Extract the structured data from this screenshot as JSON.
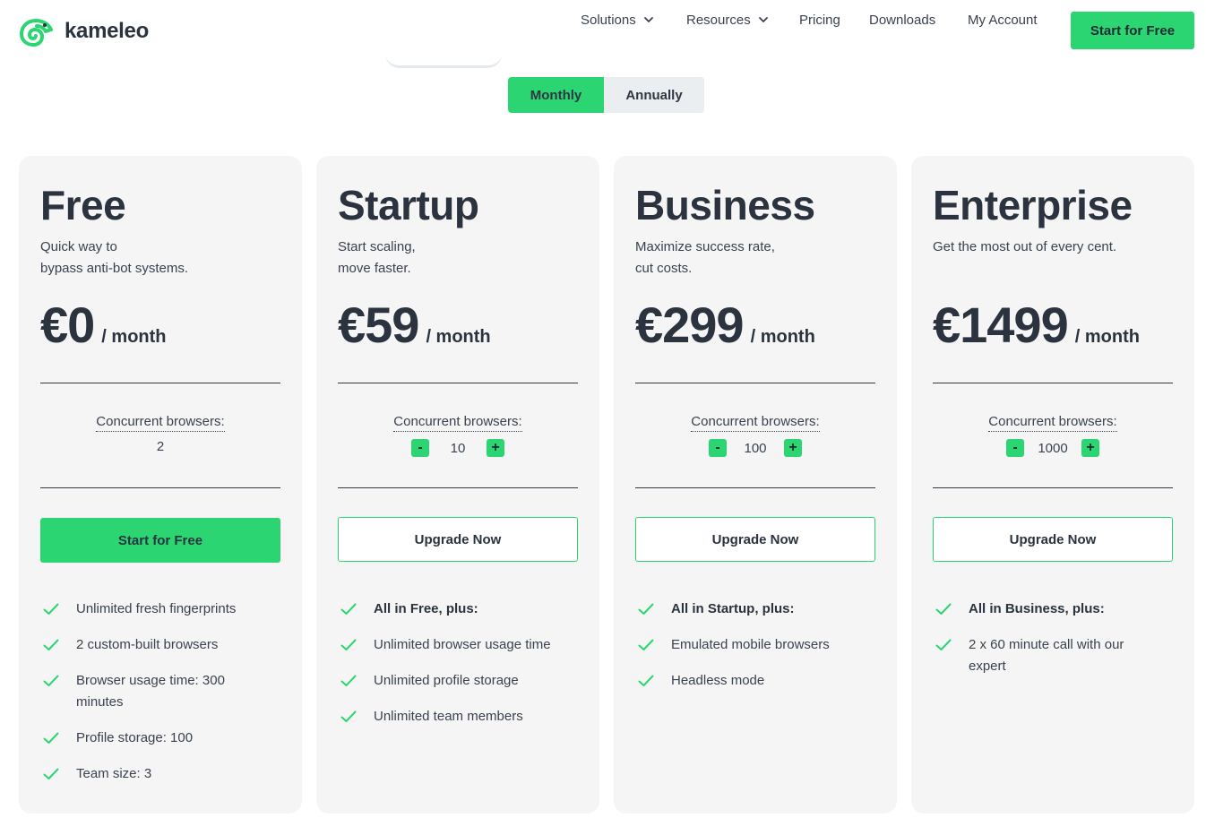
{
  "brand": {
    "name": "kameleo",
    "accent": "#2bd672"
  },
  "nav": {
    "solutions": "Solutions",
    "resources": "Resources",
    "pricing": "Pricing",
    "downloads": "Downloads",
    "my_account": "My Account",
    "cta": "Start for Free"
  },
  "billing": {
    "monthly": "Monthly",
    "annually": "Annually",
    "selected": "Monthly"
  },
  "plans": [
    {
      "name": "Free",
      "desc": [
        "Quick way to",
        "bypass anti-bot systems."
      ],
      "price": "€0",
      "period": "/ month",
      "conc_label": "Concurrent browsers:",
      "conc_value": "2",
      "button": "Start for Free",
      "features": [
        "Unlimited fresh fingerprints",
        "2 custom-built browsers",
        "Browser usage time: 300 minutes",
        "Profile storage: 100",
        "Team size: 3"
      ]
    },
    {
      "name": "Startup",
      "desc": [
        "Start scaling,",
        "move faster."
      ],
      "price": "€59",
      "period": "/ month",
      "conc_label": "Concurrent browsers:",
      "conc_value": "10",
      "button": "Upgrade Now",
      "features": [
        "All in Free, plus:",
        "Unlimited browser usage time",
        "Unlimited profile storage",
        "Unlimited team members"
      ]
    },
    {
      "name": "Business",
      "desc": [
        "Maximize success rate,",
        "cut costs."
      ],
      "price": "€299",
      "period": "/ month",
      "conc_label": "Concurrent browsers:",
      "conc_value": "100",
      "button": "Upgrade Now",
      "features": [
        "All in Startup, plus:",
        "Emulated mobile browsers",
        "Headless mode"
      ]
    },
    {
      "name": "Enterprise",
      "desc": [
        "Get the most out of every cent."
      ],
      "price": "€1499",
      "period": "/ month",
      "conc_label": "Concurrent browsers:",
      "conc_value": "1000",
      "button": "Upgrade Now",
      "features": [
        "All in Business, plus:",
        "2 x 60 minute call with our expert"
      ]
    }
  ],
  "stepper": {
    "minus": "-",
    "plus": "+"
  }
}
